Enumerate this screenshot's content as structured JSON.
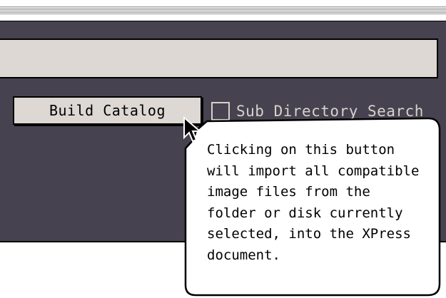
{
  "window": {
    "build_button_label": "Build Catalog",
    "subdirectory_checkbox_label": "Sub Directory Search",
    "subdirectory_checked": false,
    "path_field_value": ""
  },
  "help_balloon": {
    "text": "Clicking on this button\nwill import all compatible\nimage files from the\nfolder or disk currently\nselected, into the XPress\ndocument."
  },
  "colors": {
    "panel_background": "#46424f",
    "control_face": "#ddd8d3",
    "light_text": "#d6d2cc"
  },
  "icons": {
    "pointer": "arrow-cursor-icon"
  }
}
